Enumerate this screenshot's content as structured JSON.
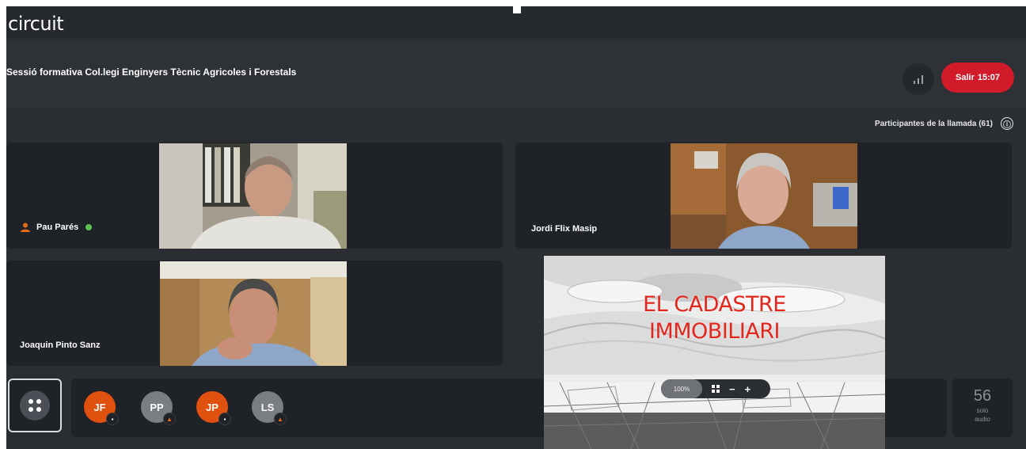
{
  "app": {
    "logo": "circuit",
    "meeting_title": "Sessió formativa Col.legi Enginyers Tècnic Agricoles i Forestals",
    "leave_button_label": "Salir",
    "leave_button_time": "15:07",
    "stats_icon": "signal-bars-icon",
    "accent_color": "#d11a2a"
  },
  "participants_bar": {
    "label": "Participantes de la llamada (61)",
    "info_icon": "ⓘ"
  },
  "tiles": [
    {
      "name": "Pau Parés",
      "moderator_icon": "user-moderator-icon",
      "speaking": true
    },
    {
      "name": "Jordi Flix Masip"
    },
    {
      "name": "Joaquin Pinto Sanz"
    }
  ],
  "screen_share": {
    "title_line1": "EL CADASTRE",
    "title_line2": "IMMOBILIARI",
    "zoom_level": "100%",
    "fit_icon": "fit-screen-icon",
    "zoom_out": "−",
    "zoom_in": "+"
  },
  "bottom_bar": {
    "grid_toggle_icon": "grid-dots-icon",
    "avatars": [
      {
        "initials": "JF",
        "color": "#e0500e",
        "badge_icon": "video-camera-icon"
      },
      {
        "initials": "PP",
        "color": "#7a7d82",
        "badge_icon": "user-moderator-icon"
      },
      {
        "initials": "JP",
        "color": "#e0500e",
        "badge_icon": "video-camera-icon"
      },
      {
        "initials": "LS",
        "color": "#7a7d82",
        "badge_icon": "user-moderator-icon"
      }
    ],
    "audio_only_count": "56",
    "audio_only_label_1": "solo",
    "audio_only_label_2": "audio"
  }
}
